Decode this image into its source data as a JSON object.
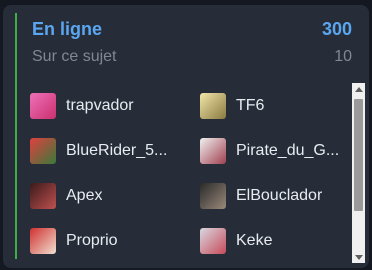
{
  "header": {
    "title": "En ligne",
    "total": "300",
    "subtitle": "Sur ce sujet",
    "subcount": "10"
  },
  "colors": {
    "accent_green": "#3fae45",
    "title_blue": "#5aa6f0"
  },
  "users": [
    {
      "name": "trapvador",
      "avatar_color": "#e84aa0"
    },
    {
      "name": "TF6",
      "avatar_color": "#d9c77a"
    },
    {
      "name": "BlueRider_5...",
      "avatar_color": "#b83232"
    },
    {
      "name": "Pirate_du_G...",
      "avatar_color": "#c8c0c0"
    },
    {
      "name": "Apex",
      "avatar_color": "#7a2a2a"
    },
    {
      "name": "ElBouclador",
      "avatar_color": "#6a6058"
    },
    {
      "name": "Proprio",
      "avatar_color": "#c83c3c"
    },
    {
      "name": "Keke",
      "avatar_color": "#b85a6a"
    }
  ]
}
